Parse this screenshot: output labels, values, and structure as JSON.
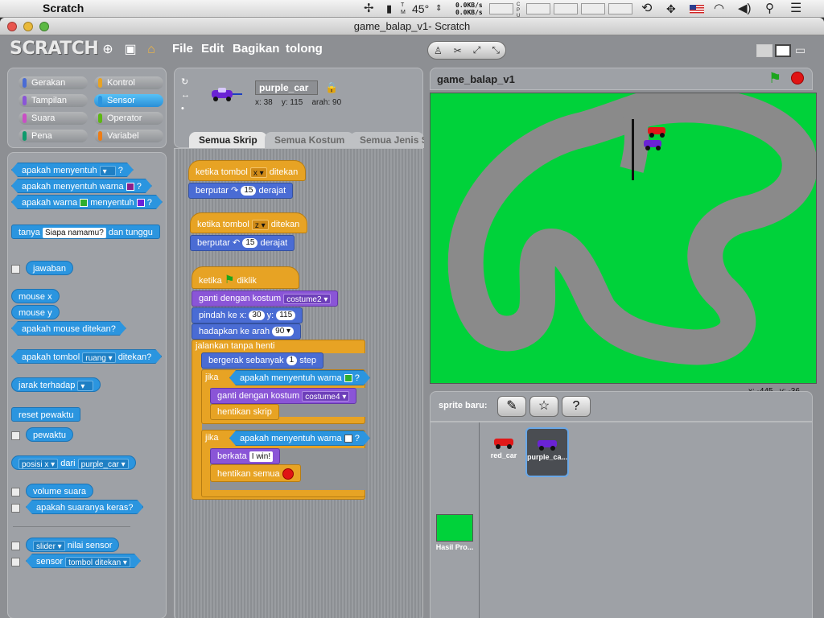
{
  "menubar": {
    "app_name": "Scratch",
    "temperature": "45°",
    "net_up": "0.0KB/s",
    "net_down": "0.0KB/s"
  },
  "window": {
    "title": "game_balap_v1- Scratch"
  },
  "toolbar": {
    "logo": "SCRATCH",
    "menus": [
      "File",
      "Edit",
      "Bagikan",
      "tolong"
    ]
  },
  "categories": [
    {
      "label": "Gerakan",
      "color": "#4a6cd4"
    },
    {
      "label": "Kontrol",
      "color": "#e7a324"
    },
    {
      "label": "Tampilan",
      "color": "#8a55d7"
    },
    {
      "label": "Sensor",
      "color": "#2b95df",
      "selected": true
    },
    {
      "label": "Suara",
      "color": "#c94fc5"
    },
    {
      "label": "Operator",
      "color": "#5cb712"
    },
    {
      "label": "Pena",
      "color": "#0e9a6c"
    },
    {
      "label": "Variabel",
      "color": "#ee7d16"
    }
  ],
  "palette": {
    "touching": "apakah menyentuh",
    "touching_q": "?",
    "touching_color": "apakah menyentuh warna",
    "color_touching_a": "apakah warna",
    "color_touching_b": "menyentuh",
    "ask_a": "tanya",
    "ask_field": "Siapa namamu?",
    "ask_b": "dan tunggu",
    "answer": "jawaban",
    "mouse_x": "mouse x",
    "mouse_y": "mouse y",
    "mouse_down": "apakah mouse ditekan?",
    "key_a": "apakah tombol",
    "key_field": "ruang",
    "key_b": "ditekan?",
    "distance": "jarak terhadap",
    "reset_timer": "reset pewaktu",
    "timer": "pewaktu",
    "of_field1": "posisi x",
    "of_mid": "dari",
    "of_field2": "purple_car",
    "loudness": "volume suara",
    "loud": "apakah suaranya keras?",
    "slider_field": "slider",
    "sensor_value": "nilai sensor",
    "sensor": "sensor",
    "sensor_field": "tombol ditekan"
  },
  "sprite": {
    "name": "purple_car",
    "x_label": "x:",
    "x": "38",
    "y_label": "y:",
    "y": "115",
    "dir_label": "arah:",
    "direction": "90"
  },
  "tabs": [
    "Semua Skrip",
    "Semua Kostum",
    "Semua Jenis Suara"
  ],
  "script": {
    "when_key": "ketika tombol",
    "pressed": "ditekan",
    "key1": "x",
    "turn": "berputar",
    "deg": "derajat",
    "turn_val1": "15",
    "key2": "z",
    "turn_val2": "15",
    "when_flag_a": "ketika",
    "when_flag_b": "diklik",
    "switch_costume": "ganti dengan kostum",
    "costume1": "costume2",
    "goto_a": "pindah ke x:",
    "goto_x": "30",
    "goto_b": "y:",
    "goto_y": "115",
    "point": "hadapkan ke arah",
    "point_val": "90",
    "forever": "jalankan tanpa henti",
    "move": "bergerak sebanyak",
    "move_val": "1",
    "move_b": "step",
    "if": "jika",
    "touching_color": "apakah menyentuh warna",
    "q": "?",
    "costume2": "costume4",
    "stop_script": "hentikan skrip",
    "say": "berkata",
    "say_val": "I win!",
    "stop_all": "hentikan semua"
  },
  "stage": {
    "title": "game_balap_v1",
    "mouse_x": "x: -445",
    "mouse_y": "y: -36",
    "colors": {
      "grass": "#00d23a",
      "track": "#8a8a8a"
    }
  },
  "sprites_panel": {
    "new_sprite": "sprite baru:",
    "items": [
      {
        "name": "red_car",
        "selected": false
      },
      {
        "name": "purple_ca...",
        "selected": true
      }
    ],
    "stage_label": "Hasil Pro..."
  }
}
